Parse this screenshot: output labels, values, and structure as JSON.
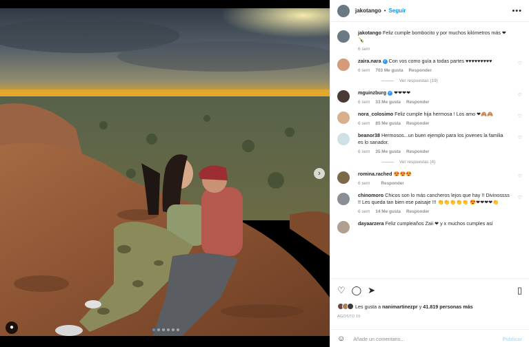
{
  "post": {
    "author": "jakotango",
    "follow_label": "Seguir",
    "more_label": "•••",
    "header_separator": "•"
  },
  "photo": {
    "next_arrow": "›",
    "user_tag_icon": "user-icon",
    "carousel_count": 6,
    "carousel_active": 0
  },
  "comments": [
    {
      "user": "jakotango",
      "verified": false,
      "text": "Feliz cumple bombocito y por muchos kilómetros más ❤🍾",
      "time": "6 sem",
      "likes": "",
      "reply": "",
      "view_replies": "",
      "avatar_color": "#6b7a82",
      "show_heart": false
    },
    {
      "user": "zaira.nara",
      "verified": true,
      "text": "Con vos como guía a todas partes ♥♥♥♥♥♥♥♥♥",
      "time": "6 sem",
      "likes": "703 Me gusta",
      "reply": "Responder",
      "view_replies": "Ver respuestas (19)",
      "avatar_color": "#d49a7a",
      "show_heart": true
    },
    {
      "user": "mguinzburg",
      "verified": true,
      "text": "❤❤❤❤",
      "time": "6 sem",
      "likes": "33 Me gusta",
      "reply": "Responder",
      "view_replies": "",
      "avatar_color": "#4a3a34",
      "show_heart": true
    },
    {
      "user": "nora_colosimo",
      "verified": false,
      "text": "Feliz cumple hija hermosa ! Los amo ❤🙈🙈",
      "time": "6 sem",
      "likes": "85 Me gusta",
      "reply": "Responder",
      "view_replies": "",
      "avatar_color": "#d8b18c",
      "show_heart": true
    },
    {
      "user": "beanor38",
      "verified": false,
      "text": "Hermosos...un buen ejemplo para los jovenes la familia es lo sanador.",
      "time": "6 sem",
      "likes": "35 Me gusta",
      "reply": "Responder",
      "view_replies": "Ver respuestas (4)",
      "avatar_color": "#cfe0e6",
      "show_heart": true
    },
    {
      "user": "romina.rached",
      "verified": false,
      "text": "😍😍😍",
      "time": "6 sem",
      "likes": "",
      "reply": "Responder",
      "view_replies": "",
      "avatar_color": "#7a6a4a",
      "show_heart": true
    },
    {
      "user": "chinomoro",
      "verified": false,
      "text": "Chicos son lo más cancheros lejos que hay !! Divinossss !! Les queda tan bien ese paisaje !!! 👏👏👏👏👏 😍❤❤❤❤👏",
      "time": "6 sem",
      "likes": "14 Me gusta",
      "reply": "Responder",
      "view_replies": "",
      "avatar_color": "#8a8f96",
      "show_heart": true
    },
    {
      "user": "dayaarzera",
      "verified": false,
      "text": "Feliz cumpleaños Zaii ❤ y x muchos cumples así",
      "time": "",
      "likes": "",
      "reply": "",
      "view_replies": "",
      "avatar_color": "#b0a090",
      "show_heart": false
    }
  ],
  "actions": {
    "like_icon": "heart-icon",
    "comment_icon": "comment-icon",
    "share_icon": "share-icon",
    "save_icon": "bookmark-icon",
    "likes_prefix": "Les gusta a",
    "likes_user": "nanimartinezpr",
    "likes_joiner": "y",
    "likes_count": "41.819 personas más",
    "date": "AGOSTO 15"
  },
  "composer": {
    "emoji_icon": "emoji-icon",
    "placeholder": "Añade un comentario...",
    "post_label": "Publicar"
  },
  "colors": {
    "accent": "#0095f6",
    "text": "#262626",
    "muted": "#8e8e8e"
  }
}
